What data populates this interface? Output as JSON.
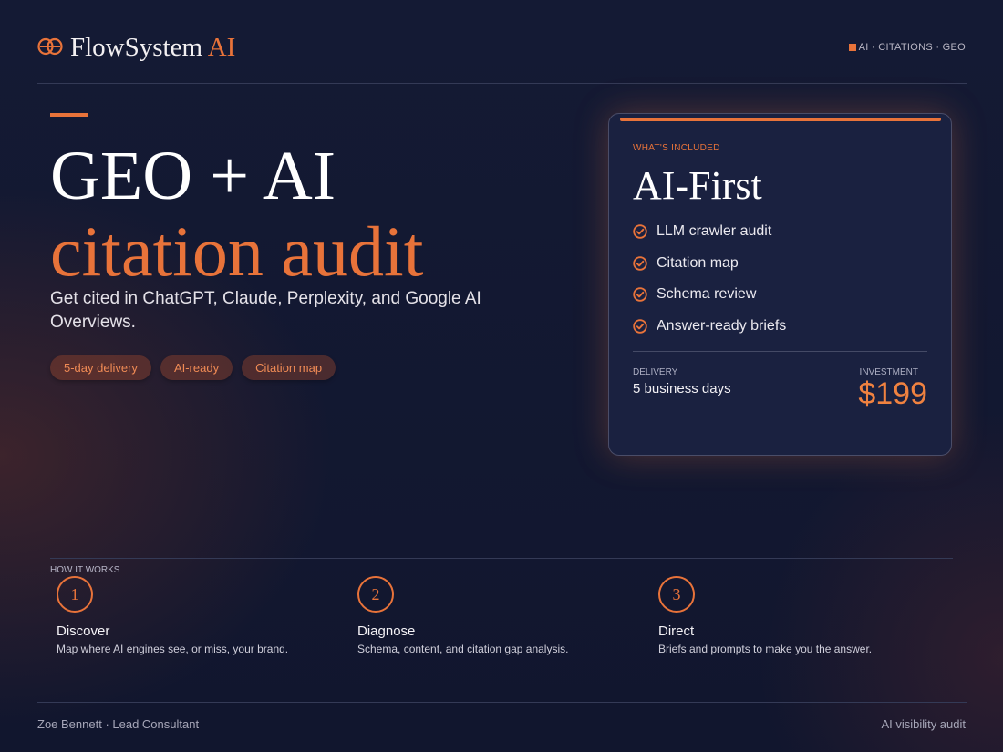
{
  "header": {
    "brand_name": "FlowSystem",
    "brand_accent": "AI",
    "logo_icon": "interlocking-rings-icon",
    "tag": "AI · CITATIONS · GEO"
  },
  "hero": {
    "line1": "GEO + AI",
    "line2": "citation audit",
    "subtitle": "Get cited in ChatGPT, Claude, Perplexity, and Google AI Overviews.",
    "chips": [
      "5-day delivery",
      "AI-ready",
      "Citation map"
    ]
  },
  "card": {
    "eyebrow": "WHAT'S INCLUDED",
    "title": "AI-First",
    "features": [
      "LLM crawler audit",
      "Citation map",
      "Schema review",
      "Answer-ready briefs"
    ],
    "feature_icon": "check-circle-icon",
    "delivery_label": "DELIVERY",
    "delivery_value": "5 business days",
    "investment_label": "INVESTMENT",
    "price": "$199"
  },
  "how_it_works": {
    "label": "HOW IT WORKS",
    "steps": [
      {
        "number": "1",
        "title": "Discover",
        "description": "Map where AI engines see, or miss, your brand."
      },
      {
        "number": "2",
        "title": "Diagnose",
        "description": "Schema, content, and citation gap analysis."
      },
      {
        "number": "3",
        "title": "Direct",
        "description": "Briefs and prompts to make you the answer."
      }
    ]
  },
  "footer": {
    "left": "Zoe Bennett · Lead Consultant",
    "right": "AI visibility audit"
  },
  "colors": {
    "accent": "#e8733a",
    "background": "#141a34",
    "card": "#1a2140"
  }
}
